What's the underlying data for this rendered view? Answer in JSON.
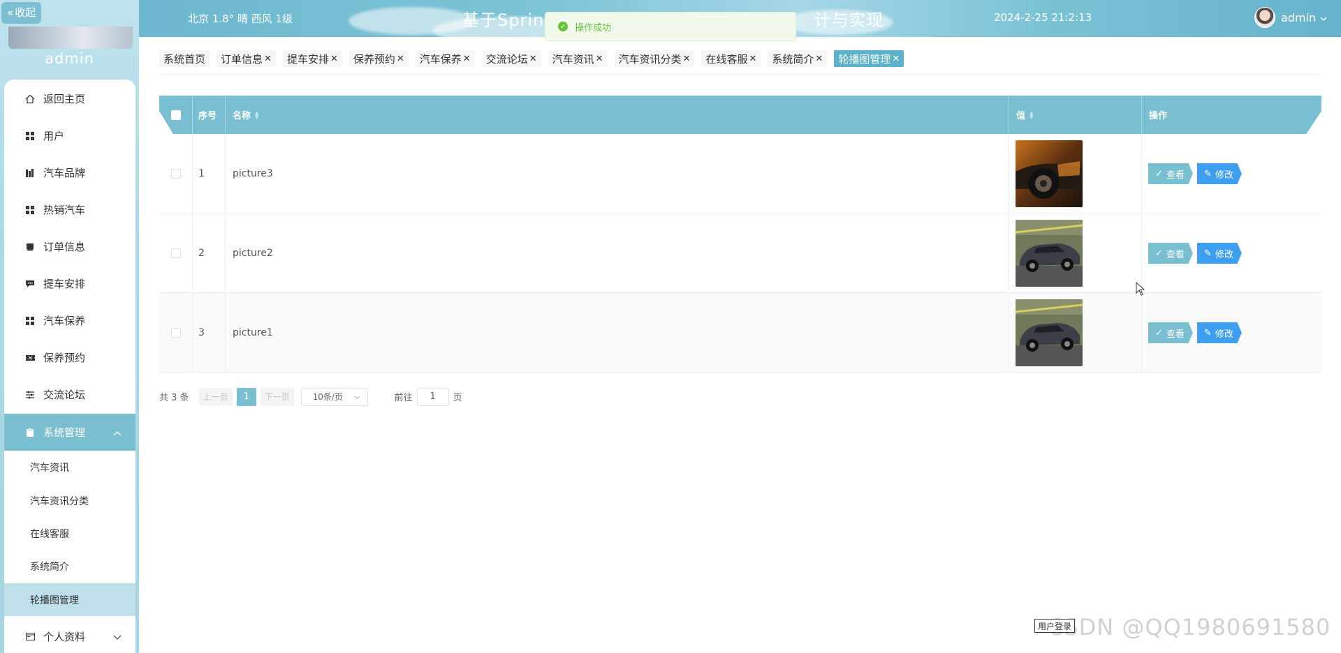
{
  "sidebar": {
    "collapse_label": "收起",
    "username": "admin",
    "menu": [
      {
        "label": "返回主页",
        "icon": "home-icon"
      },
      {
        "label": "用户",
        "icon": "grid-icon"
      },
      {
        "label": "汽车品牌",
        "icon": "book-icon"
      },
      {
        "label": "热销汽车",
        "icon": "grid-icon"
      },
      {
        "label": "订单信息",
        "icon": "cup-icon"
      },
      {
        "label": "提车安排",
        "icon": "message-icon"
      },
      {
        "label": "汽车保养",
        "icon": "grid-icon"
      },
      {
        "label": "保养预约",
        "icon": "ticket-icon"
      },
      {
        "label": "交流论坛",
        "icon": "sliders-icon"
      },
      {
        "label": "系统管理",
        "icon": "clipboard-icon"
      }
    ],
    "system_submenu": [
      "汽车资讯",
      "汽车资讯分类",
      "在线客服",
      "系统简介",
      "轮播图管理"
    ],
    "profile_label": "个人资料"
  },
  "header": {
    "weather": "北京  1.8°  晴  西风  1级",
    "title": "基于Spring",
    "title_tail": "计与实现",
    "datetime": "2024-2-25 21:2:13",
    "user": "admin"
  },
  "toast": {
    "message": "操作成功"
  },
  "tags": [
    {
      "label": "系统首页",
      "closable": false
    },
    {
      "label": "订单信息",
      "closable": true
    },
    {
      "label": "提车安排",
      "closable": true
    },
    {
      "label": "保养预约",
      "closable": true
    },
    {
      "label": "汽车保养",
      "closable": true
    },
    {
      "label": "交流论坛",
      "closable": true
    },
    {
      "label": "汽车资讯",
      "closable": true
    },
    {
      "label": "汽车资讯分类",
      "closable": true
    },
    {
      "label": "在线客服",
      "closable": true
    },
    {
      "label": "系统简介",
      "closable": true
    },
    {
      "label": "轮播图管理",
      "closable": true,
      "active": true
    }
  ],
  "table": {
    "headers": {
      "index": "序号",
      "name": "名称",
      "value": "值",
      "actions": "操作"
    },
    "rows": [
      {
        "index": "1",
        "name": "picture3"
      },
      {
        "index": "2",
        "name": "picture2"
      },
      {
        "index": "3",
        "name": "picture1"
      }
    ],
    "view_label": "查看",
    "edit_label": "修改"
  },
  "pagination": {
    "total": "共 3 条",
    "prev": "上一页",
    "page": "1",
    "next": "下一页",
    "page_size": "10条/页",
    "goto_prefix": "前往",
    "goto_value": "1",
    "goto_suffix": "页"
  },
  "footer": {
    "login_badge": "用户登录",
    "watermark": "CSDN @QQ1980691580"
  },
  "colors": {
    "accent": "#79bfd1",
    "edit": "#3e9ef0",
    "header": "#7fc4d8"
  }
}
